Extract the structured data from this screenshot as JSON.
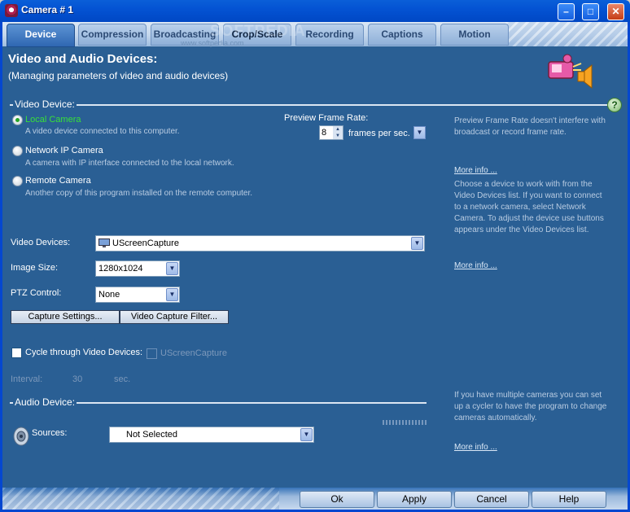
{
  "window": {
    "title": "Camera # 1"
  },
  "tabs": [
    {
      "label": "Device"
    },
    {
      "label": "Compression"
    },
    {
      "label": "Broadcasting"
    },
    {
      "label": "Crop/Scale"
    },
    {
      "label": "Recording"
    },
    {
      "label": "Captions"
    },
    {
      "label": "Motion"
    }
  ],
  "watermark": "www.softpedia.com",
  "watermark_logo": "SOFTPEDIA",
  "header": {
    "title": "Video and Audio Devices:",
    "subtitle": "(Managing parameters of video and audio devices)"
  },
  "video_device": {
    "group_label": "Video Device:",
    "options": [
      {
        "label": "Local Camera",
        "desc": "A video device connected to this computer."
      },
      {
        "label": "Network IP Camera",
        "desc": "A camera with IP interface connected to the local network."
      },
      {
        "label": "Remote Camera",
        "desc": "Another copy of this program installed on the remote computer."
      }
    ],
    "preview_rate_label": "Preview Frame Rate:",
    "preview_rate_value": "8",
    "preview_rate_unit": "frames per sec.",
    "devices_label": "Video Devices:",
    "devices_value": "UScreenCapture",
    "image_size_label": "Image Size:",
    "image_size_value": "1280x1024",
    "ptz_label": "PTZ Control:",
    "ptz_value": "None",
    "capture_settings": "Capture Settings...",
    "capture_filter": "Video Capture Filter...",
    "cycle_label": "Cycle through Video Devices:",
    "cycle_device": "UScreenCapture",
    "interval_label": "Interval:",
    "interval_value": "30",
    "interval_unit": "sec."
  },
  "audio_device": {
    "group_label": "Audio Device:",
    "sources_label": "Sources:",
    "sources_value": "Not Selected"
  },
  "help": {
    "text1": "Preview Frame Rate doesn't interfere with\nbroadcast or record frame rate.",
    "more1": "More info ...",
    "text2": "Choose a device to work with from the\nVideo Devices list. If you want to connect\nto a network camera, select Network\nCamera. To adjust the device use buttons\nappears under the Video Devices list.",
    "more2": "More info ...",
    "text3": "If you have multiple cameras you can set\nup a cycler to have the program to change\ncameras automatically.",
    "more3": "More info ..."
  },
  "buttons": {
    "ok": "Ok",
    "apply": "Apply",
    "cancel": "Cancel",
    "help": "Help"
  }
}
